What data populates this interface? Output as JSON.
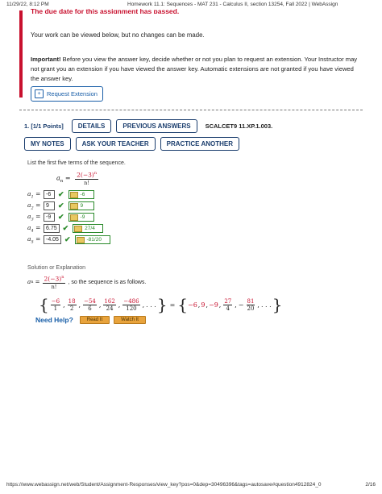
{
  "page_header": {
    "datetime": "11/29/22, 8:12 PM",
    "title": "Homework 11.1: Sequences - MAT 231 - Calculus II, section 13254, Fall 2022 | WebAssign"
  },
  "notice": {
    "truncated_text": "The due date for this assignment has passed.",
    "line1": "Your work can be viewed below, but no changes can be made.",
    "important_label": "Important!",
    "important_text": "Before you view the answer key, decide whether or not you plan to request an extension. Your Instructor may not grant you an extension if you have viewed the answer key. Automatic extensions are not granted if you have viewed the answer key.",
    "request_button": "Request Extension",
    "accent_color": "#c8102e"
  },
  "question": {
    "number_points": "1.  [1/1 Points]",
    "details_button": "DETAILS",
    "previous_answers_button": "PREVIOUS ANSWERS",
    "reference": "SCALCET9 11.XP.1.003.",
    "my_notes_button": "MY NOTES",
    "ask_teacher_button": "ASK YOUR TEACHER",
    "practice_button": "PRACTICE ANOTHER",
    "instruction": "List the first five terms of the sequence.",
    "formula_lhs": "a",
    "formula_sub": "n",
    "formula_eq": "=",
    "formula_num": "2(−3)",
    "formula_num_exp": "n",
    "formula_den": "n!",
    "answers": [
      {
        "label": "a",
        "sub": "1",
        "eq": "=",
        "value": "-6",
        "key": "-6"
      },
      {
        "label": "a",
        "sub": "2",
        "eq": "=",
        "value": "9",
        "key": "9"
      },
      {
        "label": "a",
        "sub": "3",
        "eq": "=",
        "value": "-9",
        "key": "-9"
      },
      {
        "label": "a",
        "sub": "4",
        "eq": "=",
        "value": "6.75",
        "key": "27/4"
      },
      {
        "label": "a",
        "sub": "5",
        "eq": "=",
        "value": "-4.05",
        "key": "-81/20"
      }
    ],
    "correct_color": "#2a8a2a"
  },
  "solution": {
    "title": "Solution or Explanation",
    "lead_text": ", so the sequence is as follows.",
    "seq_fracs": [
      {
        "n": "−6",
        "d": "1"
      },
      {
        "n": "18",
        "d": "2"
      },
      {
        "n": "−54",
        "d": "6"
      },
      {
        "n": "162",
        "d": "24"
      },
      {
        "n": "−486",
        "d": "120"
      }
    ],
    "ellipsis": ". . .",
    "equals": "=",
    "simplified": [
      {
        "type": "text",
        "v": "−6"
      },
      {
        "type": "text",
        "v": "9"
      },
      {
        "type": "text",
        "v": "−9"
      },
      {
        "type": "frac",
        "n": "27",
        "d": "4"
      },
      {
        "type": "frac",
        "n": "81",
        "d": "20",
        "neg": "−"
      }
    ]
  },
  "help": {
    "label": "Need Help?",
    "read_button": "Read It",
    "watch_button": "Watch It"
  },
  "page_footer": {
    "url": "https://www.webassign.net/web/Student/Assignment-Responses/view_key?pos=0&dep=30496396&tags=autosave#question4912824_0",
    "page": "2/16"
  }
}
